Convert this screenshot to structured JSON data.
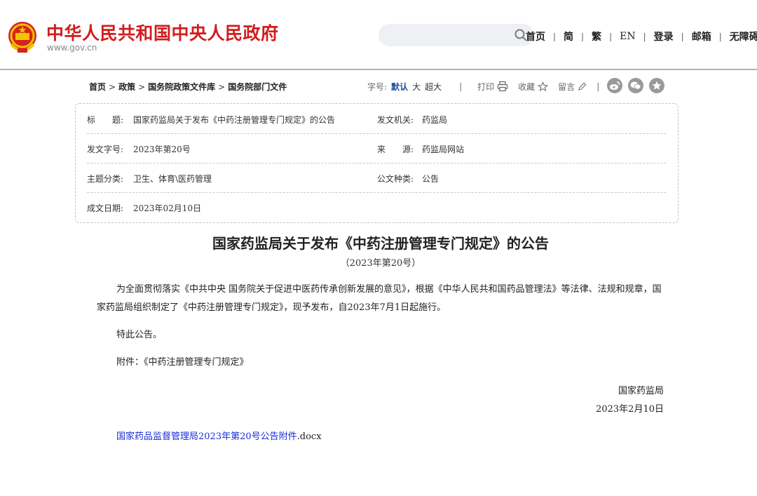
{
  "header": {
    "site_name": "中华人民共和国中央人民政府",
    "site_url": "www.gov.cn",
    "nav": [
      "首页",
      "简",
      "繁",
      "EN",
      "登录",
      "邮箱",
      "无障碍"
    ]
  },
  "breadcrumb": [
    "首页",
    "政策",
    "国务院政策文件库",
    "国务院部门文件"
  ],
  "toolbar": {
    "font_label": "字号:",
    "font_default": "默认",
    "font_large": "大",
    "font_xlarge": "超大",
    "print": "打印",
    "favorite": "收藏",
    "comment": "留言"
  },
  "info": {
    "title_label": "标　　题:",
    "title_value": "国家药监局关于发布《中药注册管理专门规定》的公告",
    "issuer_label": "发文机关:",
    "issuer_value": "药监局",
    "docno_label": "发文字号:",
    "docno_value": "2023年第20号",
    "source_label": "来　　源:",
    "source_value": "药监局网站",
    "category_label": "主题分类:",
    "category_value": "卫生、体育\\医药管理",
    "type_label": "公文种类:",
    "type_value": "公告",
    "date_label": "成文日期:",
    "date_value": "2023年02月10日"
  },
  "article": {
    "title": "国家药监局关于发布《中药注册管理专门规定》的公告",
    "subtitle": "（2023年第20号）",
    "paragraph1": "为全面贯彻落实《中共中央 国务院关于促进中医药传承创新发展的意见》，根据《中华人民共和国药品管理法》等法律、法规和规章，国家药监局组织制定了《中药注册管理专门规定》，现予发布，自2023年7月1日起施行。",
    "paragraph2": "特此公告。",
    "paragraph3": "附件：《中药注册管理专门规定》",
    "signer": "国家药监局",
    "sign_date": "2023年2月10日",
    "attachment_link": "国家药品监督管理局2023年第20号公告附件",
    "attachment_ext": ".docx"
  },
  "colors": {
    "brand_red": "#d21d1d",
    "link_blue": "#1a2bd8",
    "selected_blue": "#1d4f9c"
  }
}
